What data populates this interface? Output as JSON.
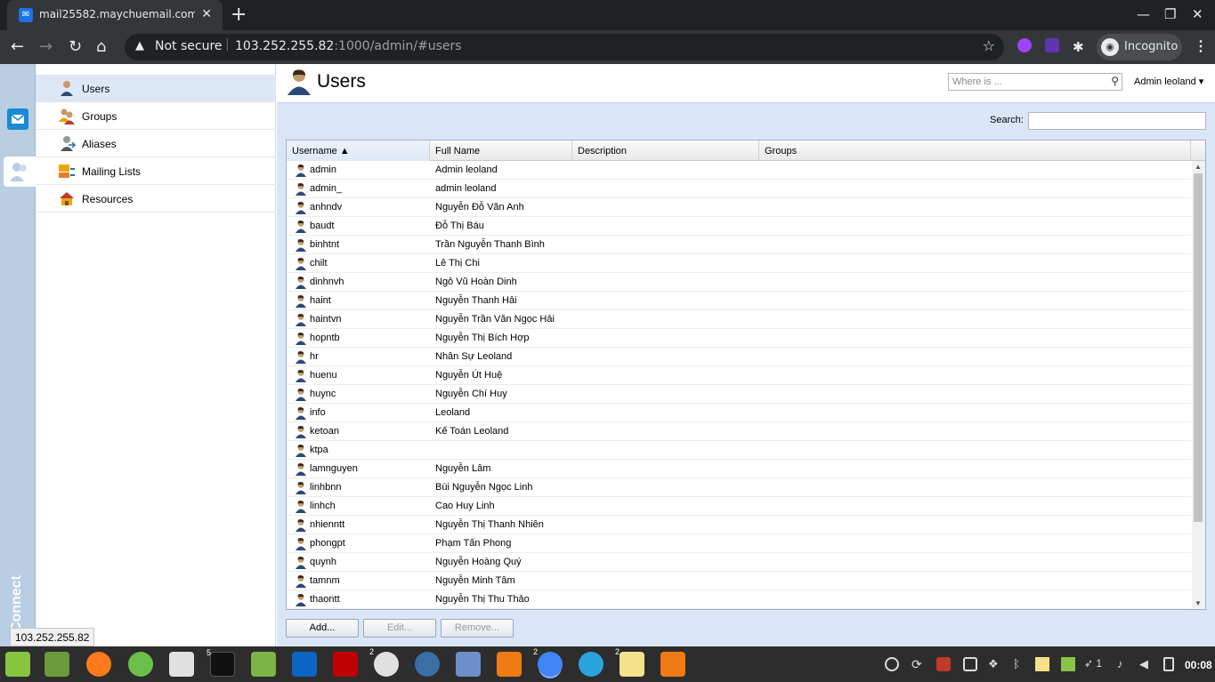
{
  "browser": {
    "tab_title": "mail25582.maychuemail.com -",
    "tab_close": "✕",
    "new_tab": "+",
    "security_label": "Not secure",
    "url_host": "103.252.255.82",
    "url_path": ":1000/admin/#users",
    "incognito_label": "Incognito",
    "status_url": "103.252.255.82"
  },
  "rail": {
    "brand": "KerioConnect"
  },
  "sidebar": {
    "items": [
      {
        "label": "Users"
      },
      {
        "label": "Groups"
      },
      {
        "label": "Aliases"
      },
      {
        "label": "Mailing Lists"
      },
      {
        "label": "Resources"
      }
    ]
  },
  "header": {
    "title": "Users",
    "where_placeholder": "Where is ...",
    "admin_menu": "Admin leoland ▾"
  },
  "search": {
    "label": "Search:",
    "value": ""
  },
  "grid": {
    "columns": [
      "Username ▲",
      "Full Name",
      "Description",
      "Groups"
    ],
    "rows": [
      {
        "username": "admin",
        "full_name": "Admin leoland"
      },
      {
        "username": "admin_",
        "full_name": "admin leoland"
      },
      {
        "username": "anhndv",
        "full_name": "Nguyễn Đỗ Văn Anh"
      },
      {
        "username": "baudt",
        "full_name": "Đỗ Thị Báu"
      },
      {
        "username": "binhtnt",
        "full_name": "Trần Nguyễn Thanh Bình"
      },
      {
        "username": "chilt",
        "full_name": "Lê Thị Chi"
      },
      {
        "username": "dinhnvh",
        "full_name": "Ngô Vũ Hoàn Dinh"
      },
      {
        "username": "haint",
        "full_name": "Nguyễn Thanh Hải"
      },
      {
        "username": "haintvn",
        "full_name": "Nguyễn Trần Văn Ngọc Hải"
      },
      {
        "username": "hopntb",
        "full_name": "Nguyễn Thị Bích Hợp"
      },
      {
        "username": "hr",
        "full_name": "Nhân Sự Leoland"
      },
      {
        "username": "huenu",
        "full_name": "Nguyễn Út Huệ"
      },
      {
        "username": "huync",
        "full_name": "Nguyễn Chí Huy"
      },
      {
        "username": "info",
        "full_name": "Leoland"
      },
      {
        "username": "ketoan",
        "full_name": "Kế Toán Leoland"
      },
      {
        "username": "ktpa",
        "full_name": ""
      },
      {
        "username": "lamnguyen",
        "full_name": "Nguyễn Lâm"
      },
      {
        "username": "linhbnn",
        "full_name": "Bùi Nguyễn Ngọc Linh"
      },
      {
        "username": "linhch",
        "full_name": "Cao Huy Linh"
      },
      {
        "username": "nhienntt",
        "full_name": "Nguyễn Thị Thanh Nhiên"
      },
      {
        "username": "phongpt",
        "full_name": "Phạm Tấn Phong"
      },
      {
        "username": "quynh",
        "full_name": "Nguyễn Hoàng Quý"
      },
      {
        "username": "tamnm",
        "full_name": "Nguyễn Minh Tâm"
      },
      {
        "username": "thaontt",
        "full_name": "Nguyễn Thị Thu Thảo"
      }
    ]
  },
  "actions": {
    "add": "Add...",
    "edit": "Edit...",
    "remove": "Remove..."
  },
  "taskbar": {
    "badges": {
      "terminal": "5",
      "xapp": "2",
      "chrome": "2",
      "notes": "2"
    },
    "tray_count": "1",
    "time": "00:08"
  },
  "colors": {
    "accent": "#dae6f7",
    "rail": "#b9cde3",
    "selected": "#dde8f7"
  }
}
